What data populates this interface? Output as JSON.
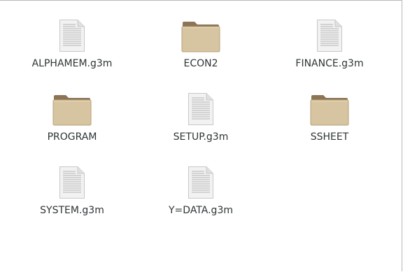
{
  "files": [
    {
      "name": "ALPHAMEM.g3m",
      "kind": "document"
    },
    {
      "name": "ECON2",
      "kind": "folder"
    },
    {
      "name": "FINANCE.g3m",
      "kind": "document"
    },
    {
      "name": "PROGRAM",
      "kind": "folder"
    },
    {
      "name": "SETUP.g3m",
      "kind": "document"
    },
    {
      "name": "SSHEET",
      "kind": "folder"
    },
    {
      "name": "SYSTEM.g3m",
      "kind": "document"
    },
    {
      "name": "Y=DATA.g3m",
      "kind": "document"
    }
  ],
  "colors": {
    "folder_front": "#d7c4a0",
    "folder_back": "#8c7455",
    "doc_paper": "#f2f2f2",
    "doc_lines": "#b4b4b4"
  }
}
